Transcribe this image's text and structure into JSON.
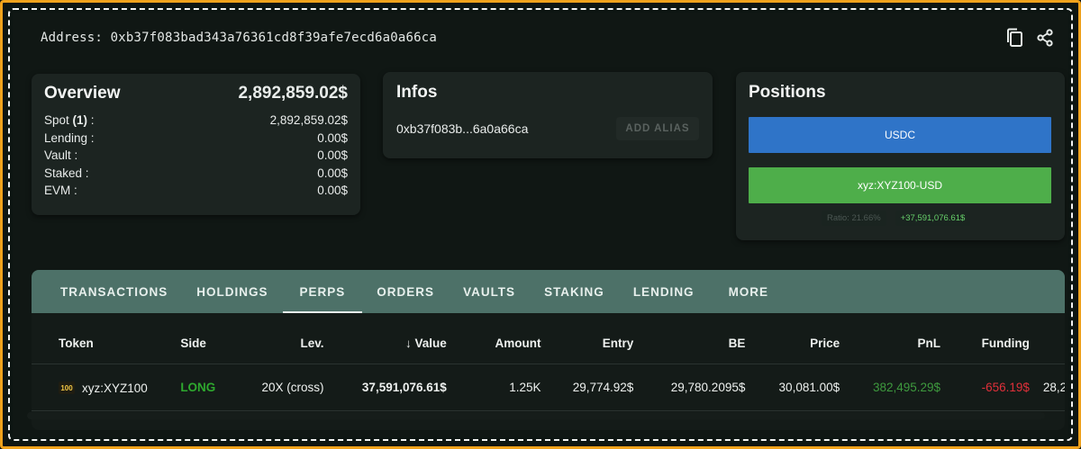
{
  "address_bar": {
    "text": "Address: 0xb37f083bad343a76361cd8f39afe7ecd6a0a66ca",
    "copy_icon": "copy-icon",
    "share_icon": "share-icon"
  },
  "overview": {
    "title": "Overview",
    "total": "2,892,859.02$",
    "rows": [
      {
        "label_prefix": "Spot ",
        "count": "(1)",
        "label_suffix": " :",
        "value": "2,892,859.02$"
      },
      {
        "label": "Lending :",
        "value": "0.00$"
      },
      {
        "label": "Vault :",
        "value": "0.00$"
      },
      {
        "label": "Staked :",
        "value": "0.00$"
      },
      {
        "label": "EVM :",
        "value": "0.00$"
      }
    ]
  },
  "infos": {
    "title": "Infos",
    "short_address": "0xb37f083b...6a0a66ca",
    "alias_button": "ADD ALIAS"
  },
  "positions": {
    "title": "Positions",
    "usdc_label": "USDC",
    "xyz_label": "xyz:XYZ100-USD",
    "ratio": "Ratio: 21.66%",
    "pnl": "+37,591,076.61$",
    "colors": {
      "usdc": "#2f74c8",
      "xyz": "#4eae4a"
    }
  },
  "tabs": [
    {
      "label": "TRANSACTIONS"
    },
    {
      "label": "HOLDINGS"
    },
    {
      "label": "PERPS",
      "active": true
    },
    {
      "label": "ORDERS"
    },
    {
      "label": "VAULTS"
    },
    {
      "label": "STAKING"
    },
    {
      "label": "LENDING"
    },
    {
      "label": "MORE"
    }
  ],
  "table": {
    "headers": {
      "token": "Token",
      "side": "Side",
      "lev": "Lev.",
      "value": "Value",
      "amount": "Amount",
      "entry": "Entry",
      "be": "BE",
      "price": "Price",
      "pnl": "PnL",
      "funding": "Funding"
    },
    "rows": [
      {
        "logo": "100",
        "token": "xyz:XYZ100",
        "side": "LONG",
        "lev": "20X (cross)",
        "value": "37,591,076.61$",
        "amount": "1.25K",
        "entry": "29,774.92$",
        "be": "29,780.2095$",
        "price": "30,081.00$",
        "pnl": "382,495.29$",
        "funding": "-656.19$",
        "extra": "28,2"
      }
    ]
  }
}
